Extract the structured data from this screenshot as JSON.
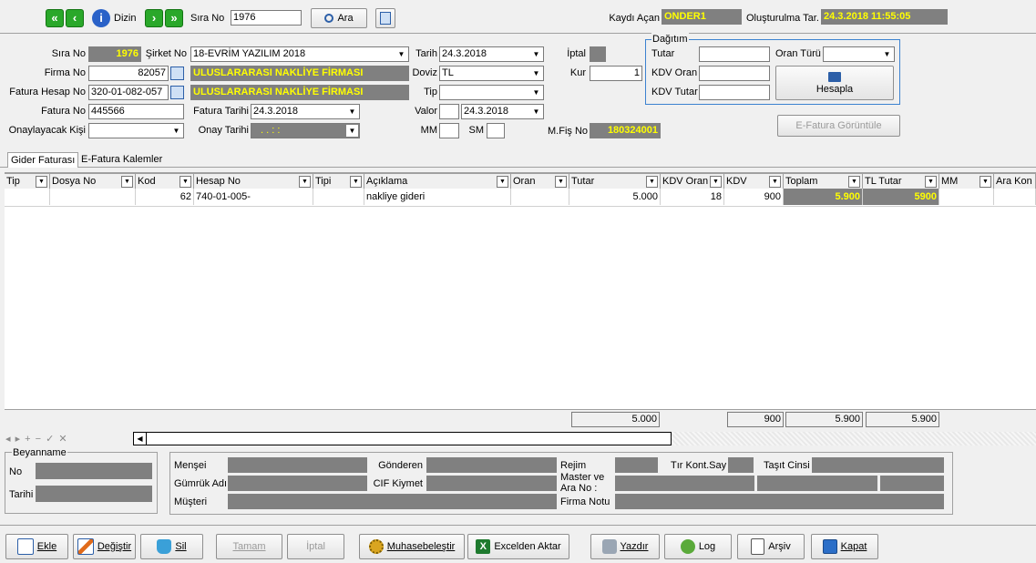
{
  "toolbar": {
    "dizin_label": "Dizin",
    "sira_no_label": "Sıra No",
    "sira_no_value": "1976",
    "ara_label": "Ara",
    "kaydi_acan_label": "Kaydı Açan",
    "kaydi_acan_value": "ONDER1",
    "olusturulma_label": "Oluşturulma Tar.",
    "olusturulma_value": "24.3.2018 11:55:05"
  },
  "form": {
    "sira_no_label": "Sıra No",
    "sira_no_value": "1976",
    "sirket_no_label": "Şirket No",
    "sirket_no_value": "18-EVRİM YAZILIM 2018",
    "tarih_label": "Tarih",
    "tarih_value": "24.3.2018",
    "iptal_label": "İptal",
    "firma_no_label": "Firma No",
    "firma_no_value": "82057",
    "firma_name": "ULUSLARARASI NAKLİYE FİRMASI",
    "doviz_label": "Doviz",
    "doviz_value": "TL",
    "kur_label": "Kur",
    "kur_value": "1",
    "fatura_hesap_no_label": "Fatura Hesap No",
    "fatura_hesap_no_value": "320-01-082-057",
    "fatura_hesap_name": "ULUSLARARASI NAKLİYE FİRMASI",
    "tip_label": "Tip",
    "tip_value": "",
    "fatura_no_label": "Fatura No",
    "fatura_no_value": "445566",
    "fatura_tarihi_label": "Fatura Tarihi",
    "fatura_tarihi_value": "24.3.2018",
    "valor_label": "Valor",
    "valor_value": "24.3.2018",
    "onaylayacak_label": "Onaylayacak Kişi",
    "onay_tarihi_label": "Onay Tarihi",
    "onay_tarihi_value": ". .  : :",
    "mm_label": "MM",
    "sm_label": "SM",
    "mfis_no_label": "M.Fiş No",
    "mfis_no_value": "180324001"
  },
  "dagitim": {
    "title": "Dağıtım",
    "tutar_label": "Tutar",
    "oran_turu_label": "Oran Türü",
    "kdv_oran_label": "KDV Oran",
    "kdv_tutar_label": "KDV Tutar",
    "hesapla_label": "Hesapla"
  },
  "efatura_button": "E-Fatura Görüntüle",
  "tabs": [
    "Gider Faturası",
    "E-Fatura Kalemler"
  ],
  "grid": {
    "columns": [
      "Tip",
      "Dosya No",
      "Kod",
      "Hesap No",
      "Tipi",
      "Açıklama",
      "Oran",
      "Tutar",
      "KDV Oran",
      "KDV",
      "Toplam",
      "TL Tutar",
      "MM",
      "Ara Kon"
    ],
    "row": [
      "",
      "",
      "62",
      "740-01-005-",
      "",
      "nakliye gideri",
      "",
      "5.000",
      "18",
      "900",
      "5.900",
      "5900",
      "",
      ""
    ],
    "totals": {
      "tutar": "5.000",
      "kdv": "900",
      "toplam": "5.900",
      "tl_tutar": "5.900"
    }
  },
  "nav_symbols": "◂ ▸ + − ✓ ✕",
  "beyanname": {
    "title": "Beyanname",
    "no_label": "No",
    "tarihi_label": "Tarihi"
  },
  "details": {
    "mensei": "Menşei",
    "gonderen": "Gönderen",
    "rejim": "Rejim",
    "tir_kont_say": "Tır Kont.Say",
    "tasit_cinsi": "Taşıt Cinsi",
    "gumruk_adi": "Gümrük Adı",
    "cif_kiymet": "CIF Kiymet",
    "master_ve": "Master ve",
    "ara_no": "Ara No :",
    "musteri": "Müşteri",
    "firma_notu": "Firma Notu"
  },
  "bottom_buttons": {
    "ekle": "Ekle",
    "degistir": "Değiştir",
    "sil": "Sil",
    "tamam": "Tamam",
    "iptal": "İptal",
    "muhasebelestir": "Muhasebeleştir",
    "excel": "Excelden Aktar",
    "yazdir": "Yazdır",
    "log": "Log",
    "arsiv": "Arşiv",
    "kapat": "Kapat"
  }
}
